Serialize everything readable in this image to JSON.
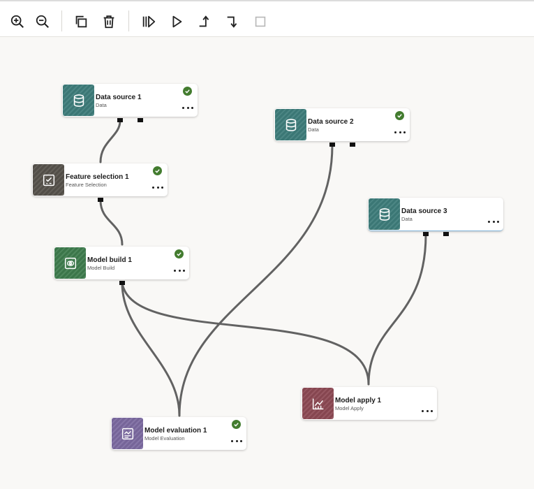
{
  "toolbar": {
    "buttons": [
      {
        "name": "zoom-in-button",
        "icon": "zoom-in-icon"
      },
      {
        "name": "zoom-out-button",
        "icon": "zoom-out-icon"
      },
      {
        "name": "copy-button",
        "icon": "copy-icon"
      },
      {
        "name": "delete-button",
        "icon": "trash-icon"
      },
      {
        "name": "run-all-button",
        "icon": "run-all-icon"
      },
      {
        "name": "run-button",
        "icon": "play-icon"
      },
      {
        "name": "run-from-button",
        "icon": "arrow-up-right-icon"
      },
      {
        "name": "run-to-button",
        "icon": "arrow-down-right-icon"
      },
      {
        "name": "stop-button",
        "icon": "stop-icon"
      }
    ]
  },
  "nodes": {
    "ds1": {
      "title": "Data source 1",
      "subtitle": "Data",
      "status": "complete",
      "icon": "database-icon"
    },
    "ds2": {
      "title": "Data source 2",
      "subtitle": "Data",
      "status": "complete",
      "icon": "database-icon"
    },
    "ds3": {
      "title": "Data source 3",
      "subtitle": "Data",
      "status": "",
      "icon": "database-icon"
    },
    "fs1": {
      "title": "Feature selection 1",
      "subtitle": "Feature Selection",
      "status": "complete",
      "icon": "feature-selection-icon"
    },
    "mb1": {
      "title": "Model build 1",
      "subtitle": "Model Build",
      "status": "complete",
      "icon": "model-build-icon"
    },
    "ma1": {
      "title": "Model apply 1",
      "subtitle": "Model Apply",
      "status": "",
      "icon": "chart-icon"
    },
    "me1": {
      "title": "Model evaluation 1",
      "subtitle": "Model Evaluation",
      "status": "complete",
      "icon": "evaluation-icon"
    }
  },
  "colors": {
    "data": "#3e7d7b",
    "feature_selection": "#57534c",
    "model_build": "#3f7d4e",
    "model_apply": "#8e4a55",
    "model_evaluation": "#7c6aa1",
    "status_ok": "#437c2f",
    "edge": "#626262"
  }
}
